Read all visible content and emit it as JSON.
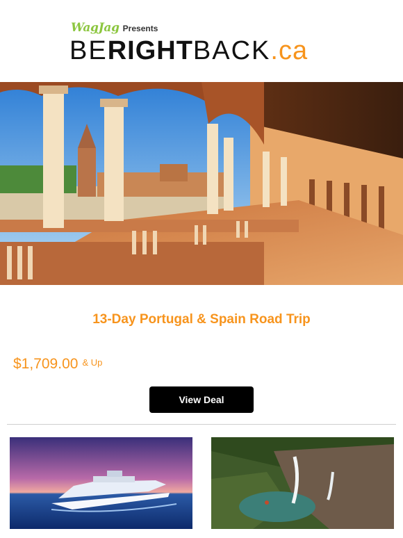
{
  "header": {
    "partner_logo": "WagJag",
    "presents": "Presents",
    "brand": {
      "part1": "BE",
      "part2": "RIGHT",
      "part3": "BACK",
      "part4": ".ca"
    }
  },
  "hero": {
    "image": "seville-plaza-de-espana-arcade-photo"
  },
  "deal": {
    "title": "13-Day Portugal & Spain Road Trip",
    "price": "$1,709.00",
    "price_suffix": "& Up",
    "button_label": "View Deal"
  },
  "thumbnails": [
    {
      "image": "cruise-ship-at-sunset-photo"
    },
    {
      "image": "waterfall-pool-photo"
    }
  ],
  "colors": {
    "accent": "#f7941d",
    "partner_green": "#8cc63f",
    "button": "#000000"
  }
}
